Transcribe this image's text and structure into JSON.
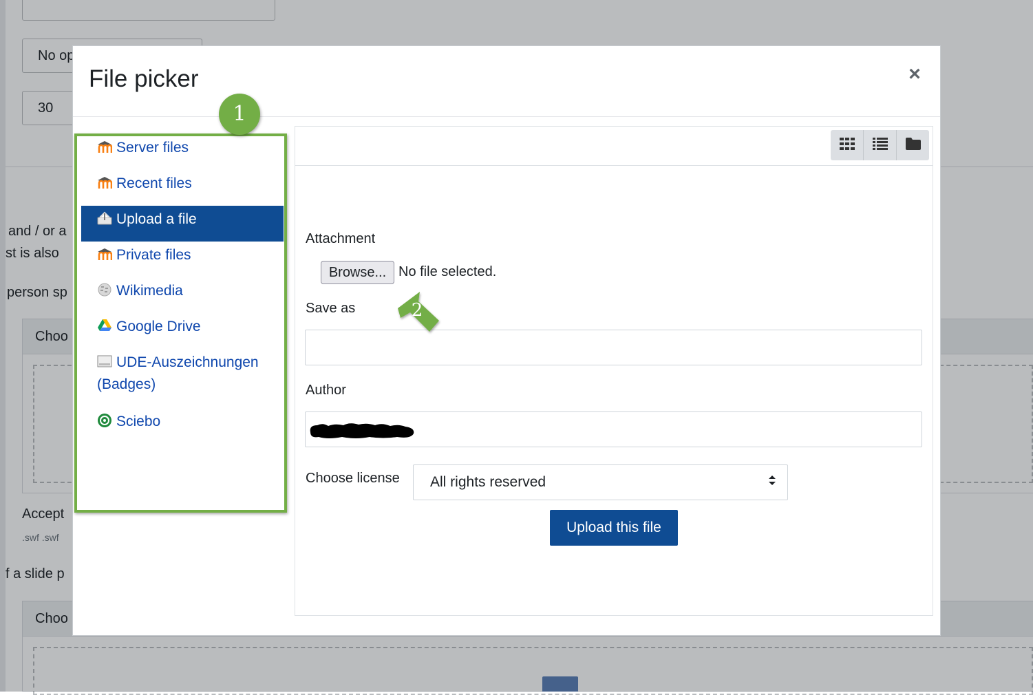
{
  "background": {
    "select_value": "No op",
    "number_value": "30",
    "text_line1": "and / or a",
    "text_line2": "st is also",
    "text_line3": "person sp",
    "choose_label_1": "Choo",
    "choose_label_2": "Choo",
    "accepted_label": "Accept",
    "accepted_types": ".swf .swf",
    "slide_text": "f a slide p"
  },
  "modal": {
    "title": "File picker",
    "close_symbol": "×"
  },
  "sidebar": {
    "items": [
      {
        "label": "Server files",
        "icon": "moodle-icon"
      },
      {
        "label": "Recent files",
        "icon": "moodle-icon"
      },
      {
        "label": "Upload a file",
        "icon": "upload-icon",
        "active": true
      },
      {
        "label": "Private files",
        "icon": "moodle-icon"
      },
      {
        "label": "Wikimedia",
        "icon": "wikipedia-icon"
      },
      {
        "label": "Google Drive",
        "icon": "google-drive-icon"
      },
      {
        "label": "UDE-Auszeichnungen (Badges)",
        "icon": "badge-icon"
      },
      {
        "label": "Sciebo",
        "icon": "sciebo-icon"
      }
    ]
  },
  "annotations": {
    "marker_1": "1",
    "marker_2": "2",
    "color": "#73ae46"
  },
  "view_buttons": [
    "grid-view-icon",
    "list-view-icon",
    "folder-view-icon"
  ],
  "upload_form": {
    "attachment_label": "Attachment",
    "browse_label": "Browse...",
    "no_file_text": "No file selected.",
    "save_as_label": "Save as",
    "save_as_value": "",
    "author_label": "Author",
    "license_label": "Choose license",
    "license_value": "All rights reserved",
    "submit_label": "Upload this file"
  },
  "colors": {
    "primary": "#0f4c93",
    "link": "#0f47ad",
    "moodle_orange": "#f98012"
  }
}
